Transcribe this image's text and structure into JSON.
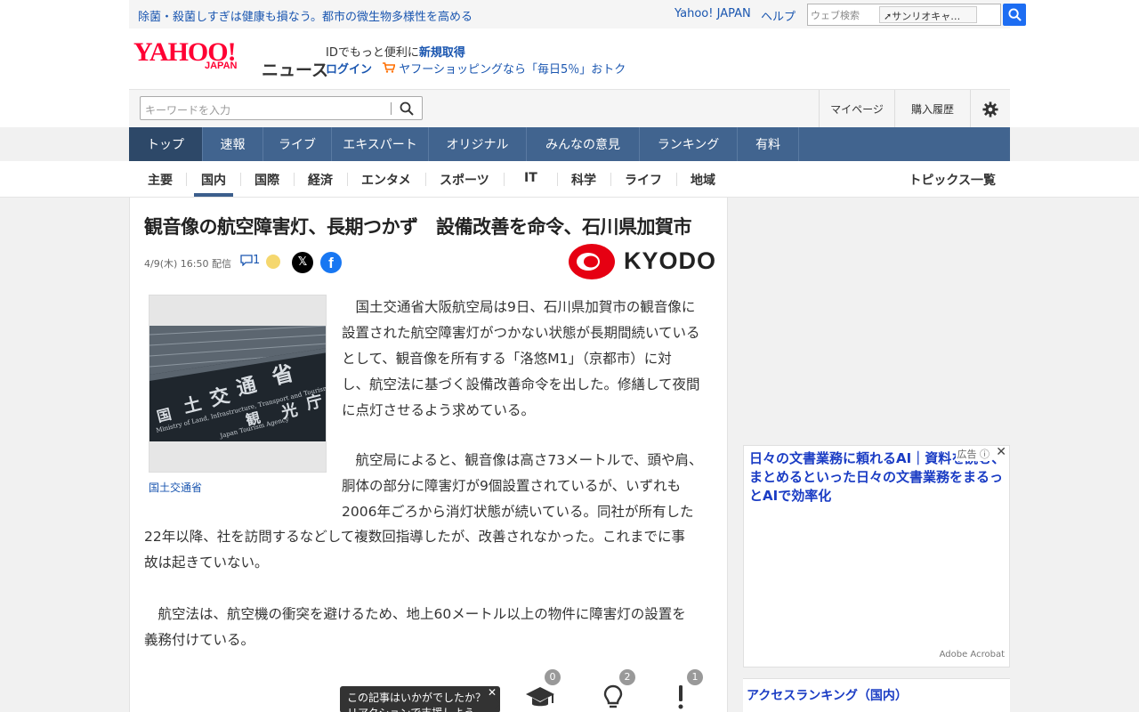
{
  "topbar": {
    "promo": "除菌・殺菌しすぎは健康も損なう。都市の微生物多様性を高める",
    "yahoo_japan": "Yahoo! JAPAN",
    "help": "ヘルプ",
    "web_search_placeholder": "ウェブ検索",
    "web_search_suggest": "サンリオキャ…"
  },
  "header": {
    "logo_main": "YAHOO!",
    "logo_sub": "JAPAN",
    "logo_section": "ニュース",
    "id_prompt": "IDでもっと便利に",
    "signup": "新規取得",
    "login": "ログイン",
    "shopping_promo": "ヤフーショッピングなら「毎日5％」おトク"
  },
  "search": {
    "placeholder": "キーワードを入力",
    "mypage": "マイページ",
    "history": "購入履歴"
  },
  "main_nav": [
    {
      "label": "トップ"
    },
    {
      "label": "速報"
    },
    {
      "label": "ライブ"
    },
    {
      "label": "エキスパート"
    },
    {
      "label": "オリジナル"
    },
    {
      "label": "みんなの意見"
    },
    {
      "label": "ランキング"
    },
    {
      "label": "有料"
    }
  ],
  "sub_nav": [
    {
      "label": "主要"
    },
    {
      "label": "国内"
    },
    {
      "label": "国際"
    },
    {
      "label": "経済"
    },
    {
      "label": "エンタメ"
    },
    {
      "label": "スポーツ"
    },
    {
      "label": "IT"
    },
    {
      "label": "科学"
    },
    {
      "label": "ライフ"
    },
    {
      "label": "地域"
    }
  ],
  "topics_link": "トピックス一覧",
  "article": {
    "headline": "観音像の航空障害灯、長期つかず　設備改善を命令、石川県加賀市",
    "published": "4/9(木) 16:50 配信",
    "comment_count": "1",
    "source_logo": "KYODO",
    "photo_caption": "国土交通省",
    "paragraph1": [
      "　国土交通省大阪航空局は9日、石川県加賀市の観音像に",
      "設置された航空障害灯がつかない状態が長期間続いている",
      "として、観音像を所有する「洛悠M1」（京都市）に対",
      "し、航空法に基づく設備改善命令を出した。修繕して夜間",
      "に点灯させるよう求めている。"
    ],
    "paragraph2_wrapped": [
      "　航空局によると、観音像は高さ73メートルで、頭や肩、",
      "胴体の部分に障害灯が9個設置されているが、いずれも",
      "2006年ごろから消灯状態が続いている。同社が所有した"
    ],
    "paragraph2_full": [
      "22年以降、社を訪問するなどして複数回指導したが、改善されなかった。これまでに事",
      "故は起きていない。"
    ],
    "paragraph3": [
      "　航空法は、航空機の衝突を避けるため、地上60メートル以上の物件に障害灯の設置を",
      "義務付けている。"
    ],
    "reaction_prompt": "この記事はいかがでしたか？",
    "reaction_prompt_2": "リアクションで支援しよう",
    "reactions": [
      {
        "icon": "graduation-cap-icon",
        "count": "0"
      },
      {
        "icon": "lightbulb-icon",
        "count": "2"
      },
      {
        "icon": "exclamation-icon",
        "count": "1"
      }
    ]
  },
  "ad": {
    "label": "広告",
    "title": "日々の文書業務に頼れるAI｜資料を読む、まとめるといった日々の文書業務をまるっとAIで効率化",
    "source": "Adobe Acrobat"
  },
  "ranking": {
    "title": "アクセスランキング（国内）"
  },
  "colors": {
    "nav_bg": "#41648f",
    "link": "#1a56b0",
    "yahoo_red": "#ff0033",
    "search_btn": "#1d6df2"
  }
}
